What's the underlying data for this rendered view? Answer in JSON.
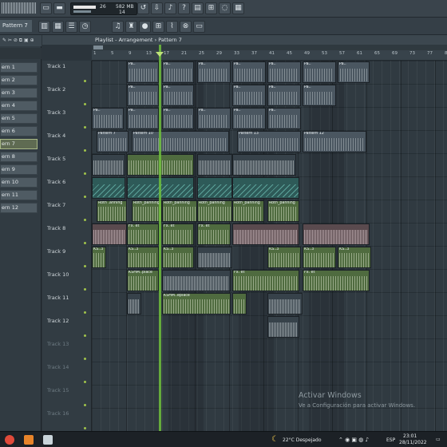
{
  "toolbar": {
    "pattern_label": "Pattern 7",
    "monitor_num1": "26",
    "monitor_mem": "582 MB",
    "monitor_num2": "14"
  },
  "playlist": {
    "title": "Playlist - Arrangement",
    "breadcrumb_sep": "›",
    "pattern": "Pattern 7"
  },
  "ruler_ticks": [
    "1",
    "5",
    "9",
    "13",
    "17",
    "21",
    "25",
    "29",
    "33",
    "37",
    "41",
    "45",
    "49",
    "53",
    "57",
    "61",
    "65",
    "69",
    "73",
    "77",
    "81",
    "85"
  ],
  "channel_list": [
    "ern 1",
    "ern 2",
    "ern 3",
    "ern 4",
    "ern 5",
    "ern 6",
    "ern 7",
    "ern 8",
    "ern 9",
    "ern 10",
    "ern 11",
    "ern 12"
  ],
  "tracks": [
    "Track 1",
    "Track 2",
    "Track 3",
    "Track 4",
    "Track 5",
    "Track 6",
    "Track 7",
    "Track 8",
    "Track 9",
    "Track 10",
    "Track 11",
    "Track 12",
    "Track 13",
    "Track 14",
    "Track 15",
    "Track 16"
  ],
  "clip_labels": {
    "pattern": "Pa..",
    "pattern7": "Pattern 7",
    "pattern10": "Pattern 10",
    "pattern13": "Pattern 13",
    "pattern12": "Pattern 12",
    "roth": "Roth .anning",
    "roth_pan": "Roth_panning",
    "fx": "Fx. et",
    "ks": "KS..3",
    "kshm": "KSHM..place",
    "kshm_replace": "KSHM..eplace"
  },
  "watermark": {
    "title": "Activar Windows",
    "subtitle": "Ve a Configuración para activar Windows."
  },
  "taskbar": {
    "weather": "22°C  Despejado",
    "lang": "ESP",
    "time": "23:01",
    "date": "28/11/2022"
  }
}
